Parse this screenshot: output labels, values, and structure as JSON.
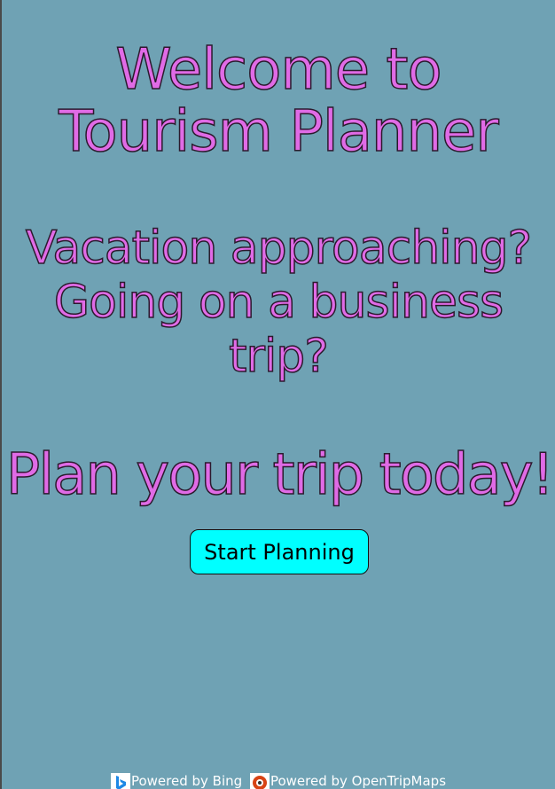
{
  "hero": {
    "title_line1": "Welcome to",
    "title_line2": "Tourism Planner",
    "subtitle_line1": "Vacation approaching?",
    "subtitle_line2": "Going on a business",
    "subtitle_line3": "trip?",
    "cta_text": "Plan your trip today!"
  },
  "actions": {
    "start_label": "Start Planning"
  },
  "footer": {
    "bing_credit": "Powered by Bing",
    "opentripmaps_credit": "Powered by OpenTripMaps"
  },
  "colors": {
    "background": "#6fa2b4",
    "heading_fill": "#e06be6",
    "button_bg": "#00ffff"
  },
  "icons": {
    "bing": "bing-logo-icon",
    "opentripmaps": "opentripmaps-logo-icon"
  }
}
